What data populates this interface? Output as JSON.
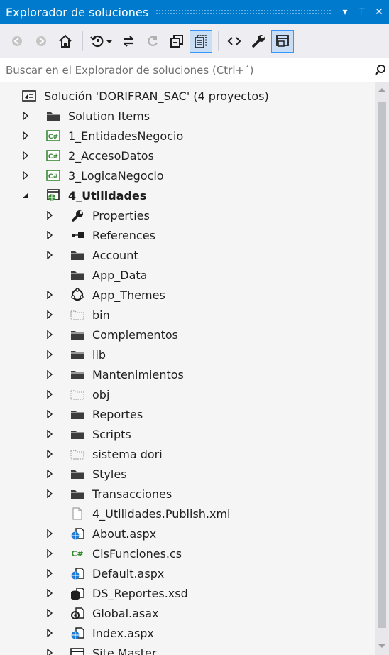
{
  "window": {
    "title": "Explorador de soluciones",
    "dropdown_glyph": "▾",
    "pin_glyph": "⫪",
    "close_glyph": "✕"
  },
  "search": {
    "placeholder": "Buscar en el Explorador de soluciones (Ctrl+´)"
  },
  "toolbar": {
    "buttons": [
      "back-icon",
      "forward-icon",
      "home-icon",
      "history-icon",
      "sync-icon",
      "refresh-icon",
      "collapse-all-icon",
      "show-all-files-icon",
      "view-code-icon",
      "properties-icon",
      "preview-icon"
    ]
  },
  "tree": {
    "items": [
      {
        "label": "Solución 'DORIFRAN_SAC'  (4 proyectos)",
        "icon": "solution-icon",
        "expand": "none",
        "bold": false
      },
      {
        "label": "Solution Items",
        "icon": "folder-icon",
        "expand": "collapsed",
        "bold": false
      },
      {
        "label": "1_EntidadesNegocio",
        "icon": "csharp-project-icon",
        "expand": "collapsed",
        "bold": false
      },
      {
        "label": "2_AccesoDatos",
        "icon": "csharp-project-icon",
        "expand": "collapsed",
        "bold": false
      },
      {
        "label": "3_LogicaNegocio",
        "icon": "csharp-project-icon",
        "expand": "collapsed",
        "bold": false
      },
      {
        "label": "4_Utilidades",
        "icon": "web-project-icon",
        "expand": "expanded",
        "bold": true
      },
      {
        "label": "Properties",
        "icon": "wrench-icon",
        "expand": "collapsed",
        "bold": false
      },
      {
        "label": "References",
        "icon": "references-icon",
        "expand": "collapsed",
        "bold": false
      },
      {
        "label": "Account",
        "icon": "folder-icon",
        "expand": "collapsed",
        "bold": false
      },
      {
        "label": "App_Data",
        "icon": "folder-icon",
        "expand": "none",
        "bold": false
      },
      {
        "label": "App_Themes",
        "icon": "themes-icon",
        "expand": "collapsed",
        "bold": false
      },
      {
        "label": "bin",
        "icon": "hidden-folder-icon",
        "expand": "collapsed",
        "bold": false
      },
      {
        "label": "Complementos",
        "icon": "folder-icon",
        "expand": "collapsed",
        "bold": false
      },
      {
        "label": "lib",
        "icon": "folder-icon",
        "expand": "collapsed",
        "bold": false
      },
      {
        "label": "Mantenimientos",
        "icon": "folder-icon",
        "expand": "collapsed",
        "bold": false
      },
      {
        "label": "obj",
        "icon": "hidden-folder-icon",
        "expand": "collapsed",
        "bold": false
      },
      {
        "label": "Reportes",
        "icon": "folder-icon",
        "expand": "collapsed",
        "bold": false
      },
      {
        "label": "Scripts",
        "icon": "folder-icon",
        "expand": "collapsed",
        "bold": false
      },
      {
        "label": "sistema dori",
        "icon": "hidden-folder-icon",
        "expand": "collapsed",
        "bold": false
      },
      {
        "label": "Styles",
        "icon": "folder-icon",
        "expand": "collapsed",
        "bold": false
      },
      {
        "label": "Transacciones",
        "icon": "folder-icon",
        "expand": "collapsed",
        "bold": false
      },
      {
        "label": "4_Utilidades.Publish.xml",
        "icon": "file-icon",
        "expand": "none",
        "bold": false
      },
      {
        "label": "About.aspx",
        "icon": "aspx-icon",
        "expand": "collapsed",
        "bold": false
      },
      {
        "label": "ClsFunciones.cs",
        "icon": "csharp-file-icon",
        "expand": "collapsed",
        "bold": false
      },
      {
        "label": "Default.aspx",
        "icon": "aspx-icon",
        "expand": "collapsed",
        "bold": false
      },
      {
        "label": "DS_Reportes.xsd",
        "icon": "dataset-icon",
        "expand": "collapsed",
        "bold": false
      },
      {
        "label": "Global.asax",
        "icon": "asax-icon",
        "expand": "collapsed",
        "bold": false
      },
      {
        "label": "Index.aspx",
        "icon": "aspx-icon",
        "expand": "collapsed",
        "bold": false
      },
      {
        "label": "Site.Master",
        "icon": "master-icon",
        "expand": "collapsed",
        "bold": false
      }
    ]
  },
  "colors": {
    "accent": "#007acc",
    "panel_bg": "#f5f5f5",
    "toolbar_bg": "#eeeef2",
    "folder": "#3c3c3c",
    "csharp": "#388a34",
    "web": "#1e7bd6"
  }
}
